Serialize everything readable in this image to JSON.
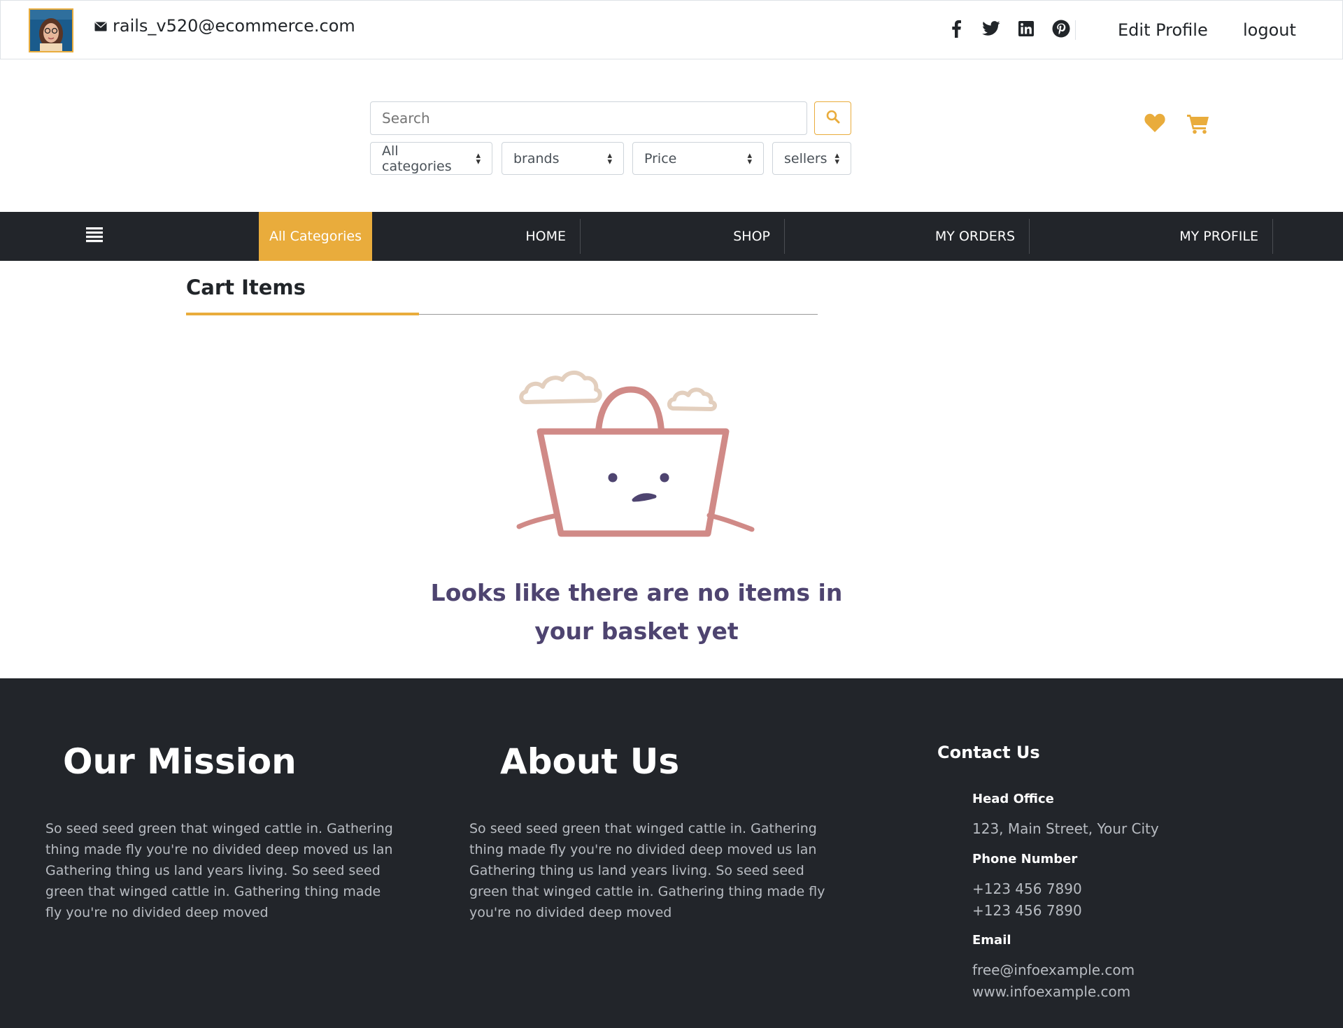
{
  "topbar": {
    "email": "rails_v520@ecommerce.com",
    "edit_profile": "Edit Profile",
    "logout": "logout"
  },
  "search": {
    "placeholder": "Search",
    "categories": "All categories",
    "brands": "brands",
    "price": "Price",
    "sellers": "sellers"
  },
  "nav": {
    "all_categories": "All Categories",
    "items": [
      "HOME",
      "SHOP",
      "MY ORDERS",
      "MY PROFILE"
    ]
  },
  "cart": {
    "title": "Cart Items",
    "empty_message": "Looks like there are no items in your basket yet"
  },
  "footer": {
    "mission_title": "Our Mission",
    "mission_text": "So seed seed green that winged cattle in. Gathering thing made fly you're no divided deep moved us lan Gathering thing us land years living. So seed seed green that winged cattle in. Gathering thing made fly you're no divided deep moved",
    "about_title": "About Us",
    "about_text": "So seed seed green that winged cattle in. Gathering thing made fly you're no divided deep moved us lan Gathering thing us land years living. So seed seed green that winged cattle in. Gathering thing made fly you're no divided deep moved",
    "contact_title": "Contact Us",
    "head_office_label": "Head Office",
    "head_office_value": "123, Main Street, Your City",
    "phone_label": "Phone Number",
    "phone_1": "+123 456 7890",
    "phone_2": "+123 456 7890",
    "email_label": "Email",
    "email_1": "free@infoexample.com",
    "email_2": "www.infoexample.com"
  },
  "colors": {
    "accent": "#e9ac3c",
    "dark": "#22252a",
    "basket": "#d08a87",
    "cloud": "#e3cfbe",
    "message": "#4e4470"
  },
  "icons": [
    "envelope-icon",
    "facebook-icon",
    "twitter-icon",
    "linkedin-icon",
    "pinterest-icon",
    "search-icon",
    "heart-icon",
    "cart-icon",
    "hamburger-icon",
    "empty-basket-illustration"
  ]
}
